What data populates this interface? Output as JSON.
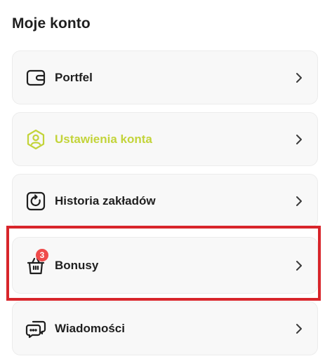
{
  "page": {
    "title": "Moje konto"
  },
  "menu": [
    {
      "label": "Portfel",
      "icon": "wallet-icon",
      "active": false
    },
    {
      "label": "Ustawienia konta",
      "icon": "user-settings-icon",
      "active": true
    },
    {
      "label": "Historia zakładów",
      "icon": "history-icon",
      "active": false
    },
    {
      "label": "Bonusy",
      "icon": "gift-basket-icon",
      "active": false,
      "badge": "3"
    },
    {
      "label": "Wiadomości",
      "icon": "messages-icon",
      "active": false
    }
  ],
  "colors": {
    "accent": "#c3d43a",
    "badge": "#ef4b4b",
    "highlight": "#d8252b",
    "text": "#1f1f1f"
  }
}
